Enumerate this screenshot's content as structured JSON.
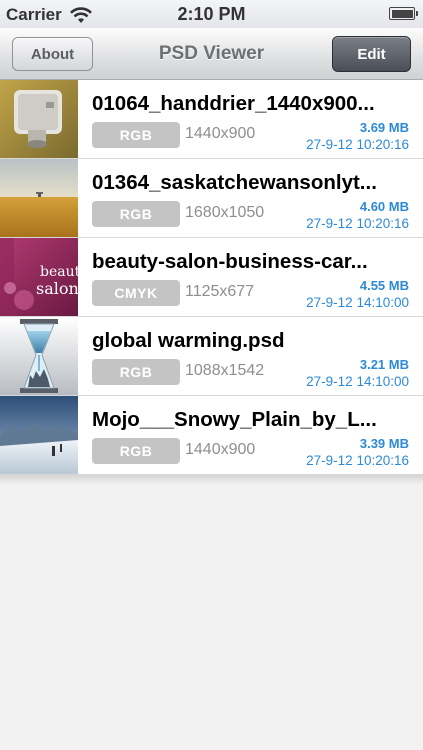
{
  "status_bar": {
    "carrier": "Carrier",
    "time": "2:10 PM",
    "icons": [
      "wifi-icon",
      "battery-icon"
    ]
  },
  "nav": {
    "title": "PSD Viewer",
    "left_button": "About",
    "right_button": "Edit"
  },
  "colors": {
    "accent": "#2d8ad6",
    "badge": "#c4c4c4"
  },
  "files": [
    {
      "name": "01064_handdrier_1440x900...",
      "mode": "RGB",
      "dimensions": "1440x900",
      "size": "3.69 MB",
      "date": "27-9-12 10:20:16",
      "thumbnail": "hand-dryer-thumbnail"
    },
    {
      "name": "01364_saskatchewansonlyt...",
      "mode": "RGB",
      "dimensions": "1680x1050",
      "size": "4.60 MB",
      "date": "27-9-12 10:20:16",
      "thumbnail": "prairie-thumbnail"
    },
    {
      "name": "beauty-salon-business-car...",
      "mode": "CMYK",
      "dimensions": "1125x677",
      "size": "4.55 MB",
      "date": "27-9-12 14:10:00",
      "thumbnail": "beauty-salon-thumbnail"
    },
    {
      "name": "global warming.psd",
      "mode": "RGB",
      "dimensions": "1088x1542",
      "size": "3.21 MB",
      "date": "27-9-12 14:10:00",
      "thumbnail": "hourglass-thumbnail"
    },
    {
      "name": "Mojo___Snowy_Plain_by_L...",
      "mode": "RGB",
      "dimensions": "1440x900",
      "size": "3.39 MB",
      "date": "27-9-12 10:20:16",
      "thumbnail": "snowy-plain-thumbnail"
    }
  ],
  "thumb_text": {
    "salon_big": "beaut",
    "salon_big2": "salon"
  }
}
